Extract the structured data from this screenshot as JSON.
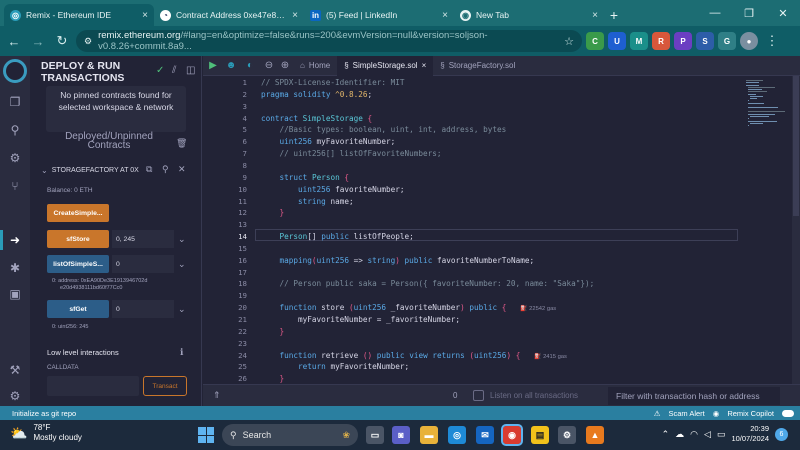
{
  "browser": {
    "tabs": [
      {
        "label": "Remix - Ethereum IDE",
        "icon": "remix-icon",
        "active": true
      },
      {
        "label": "Contract Address 0xe47e877D0",
        "icon": "etherscan-icon",
        "active": false
      },
      {
        "label": "(5) Feed | LinkedIn",
        "icon": "linkedin-icon",
        "active": false
      },
      {
        "label": "New Tab",
        "icon": "chrome-icon",
        "active": false
      }
    ],
    "url_host": "remix.ethereum.org",
    "url_rest": "/#lang=en&optimize=false&runs=200&evmVersion=null&version=soljson-v0.8.26+commit.8a9...",
    "extensions": [
      "C",
      "U",
      "M",
      "R",
      "P",
      "S",
      "G"
    ]
  },
  "sidebar": {
    "title": "DEPLOY & RUN\nTRANSACTIONS",
    "pinned_message": "No pinned contracts found for selected workspace & network",
    "deployed_label": "Deployed/Unpinned Contracts",
    "instance_label": "STORAGEFACTORY AT 0X",
    "balance": "Balance: 0 ETH",
    "functions": [
      {
        "name": "CreateSimple...",
        "style": "orange",
        "input": ""
      },
      {
        "name": "sfStore",
        "style": "orange",
        "input": "0, 245"
      },
      {
        "name": "listOfSimpleS...",
        "style": "blue",
        "input": "0"
      },
      {
        "name": "sfGet",
        "style": "blue",
        "input": "0"
      }
    ],
    "list_output_1": "0: address: 0xEA90De3E1913946702d",
    "list_output_2": "e20d4938111bd60f77Cc0",
    "get_output": "0: uint256: 245",
    "low_level_label": "Low level interactions",
    "calldata_label": "CALLDATA",
    "transact_label": "Transact"
  },
  "editor": {
    "home_tab": "Home",
    "tabs": [
      "SimpleStorage.sol",
      "StorageFactory.sol"
    ],
    "active_tab": "SimpleStorage.sol",
    "current_line": 14,
    "lines": [
      "// SPDX-License-Identifier: MIT",
      "pragma solidity ^0.8.26;",
      "",
      "contract SimpleStorage {",
      "    //Basic types: boolean, uint, int, address, bytes",
      "    uint256 myFavoriteNumber;",
      "    // uint256[] listOfFavoriteNumbers;",
      "",
      "    struct Person {",
      "        uint256 favoriteNumber;",
      "        string name;",
      "    }",
      "",
      "    Person[] public listOfPeople;",
      "",
      "    mapping(uint256 => string) public favoriteNumberToName;",
      "",
      "    // Person public saka = Person({ favoriteNumber: 20, name: \"Saka\"});",
      "",
      "    function store (uint256 _favoriteNumber) public {",
      "        myFavoriteNumber = _favoriteNumber;",
      "    }",
      "",
      "    function retrieve () public view returns (uint256) {",
      "        return myFavoriteNumber;",
      "    }"
    ],
    "gas_store": "22542 gas",
    "gas_retrieve": "2415 gas"
  },
  "terminal": {
    "count": "0",
    "listen_label": "Listen on all transactions",
    "filter_placeholder": "Filter with transaction hash or address"
  },
  "statusbar": {
    "left": "Initialize as git repo",
    "scam_alert": "Scam Alert",
    "copilot": "Remix Copilot"
  },
  "taskbar": {
    "temp": "78°F",
    "weather": "Mostly cloudy",
    "search": "Search",
    "time": "20:39",
    "date": "10/07/2024",
    "notif_count": "6"
  }
}
